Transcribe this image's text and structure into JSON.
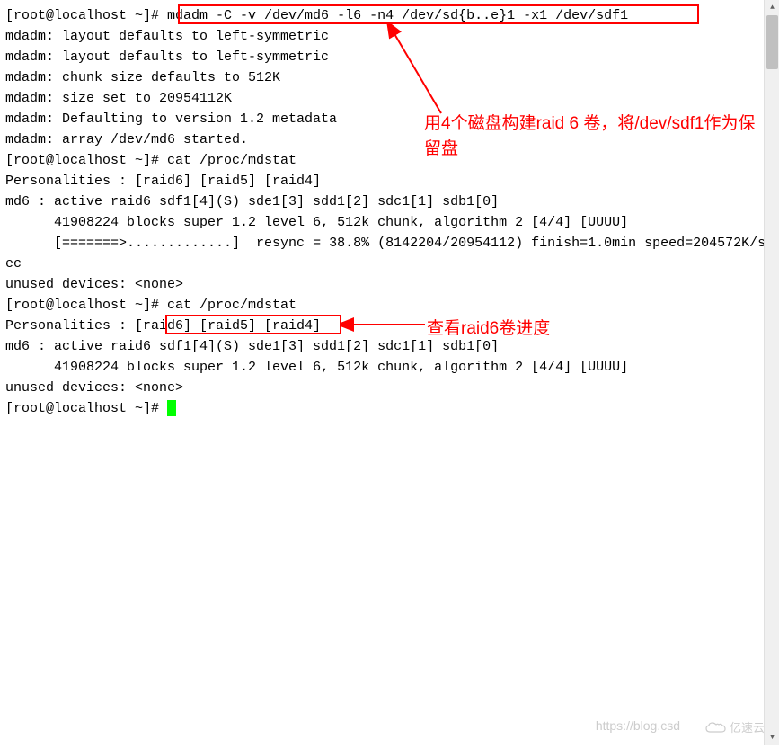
{
  "terminal": {
    "lines": [
      {
        "prompt": "[root@localhost ~]#",
        "cmd": " mdadm -C -v /dev/md6 -l6 -n4 /dev/sd{b..e}1 -x1 /dev/sdf1"
      },
      {
        "text": "mdadm: layout defaults to left-symmetric"
      },
      {
        "text": "mdadm: layout defaults to left-symmetric"
      },
      {
        "text": "mdadm: chunk size defaults to 512K"
      },
      {
        "text": "mdadm: size set to 20954112K"
      },
      {
        "text": "mdadm: Defaulting to version 1.2 metadata"
      },
      {
        "text": "mdadm: array /dev/md6 started."
      },
      {
        "prompt": "[root@localhost ~]#",
        "cmd": " cat /proc/mdstat"
      },
      {
        "text": "Personalities : [raid6] [raid5] [raid4]"
      },
      {
        "text": "md6 : active raid6 sdf1[4](S) sde1[3] sdd1[2] sdc1[1] sdb1[0]"
      },
      {
        "text": "      41908224 blocks super 1.2 level 6, 512k chunk, algorithm 2 [4/4] [UUUU]"
      },
      {
        "text": "      [=======>.............]  resync = 38.8% (8142204/20954112) finish=1.0min speed=204572K/sec"
      },
      {
        "text": ""
      },
      {
        "text": "unused devices: <none>"
      },
      {
        "prompt": "[root@localhost ~]#",
        "cmd": " cat /proc/mdstat"
      },
      {
        "text": "Personalities : [raid6] [raid5] [raid4]"
      },
      {
        "text": "md6 : active raid6 sdf1[4](S) sde1[3] sdd1[2] sdc1[1] sdb1[0]"
      },
      {
        "text": "      41908224 blocks super 1.2 level 6, 512k chunk, algorithm 2 [4/4] [UUUU]"
      },
      {
        "text": ""
      },
      {
        "text": "unused devices: <none>"
      },
      {
        "prompt": "[root@localhost ~]#",
        "cmd": " ",
        "cursor": true
      }
    ]
  },
  "annotations": {
    "note1": "用4个磁盘构建raid 6 卷，将/dev/sdf1作为保留盘",
    "note2": "查看raid6卷进度"
  },
  "watermark": {
    "url": "https://blog.csd",
    "brand": "亿速云"
  }
}
